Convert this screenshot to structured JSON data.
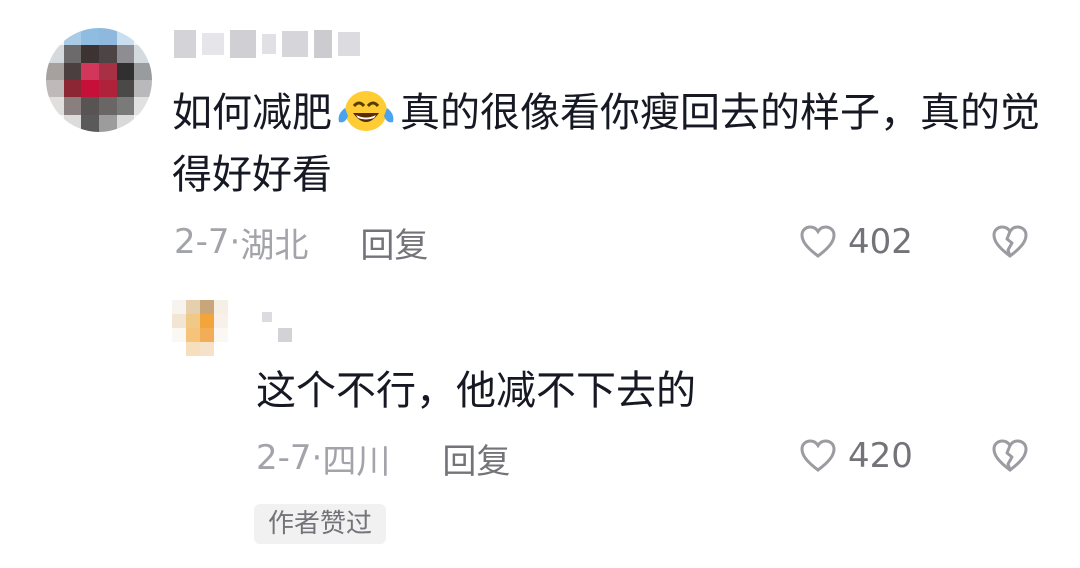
{
  "comments": {
    "main": {
      "avatar_icon": "blurred-avatar",
      "text_before_emoji": "如何减肥",
      "emoji": "laughing-crying-emoji",
      "text_after_emoji": "真的很像看你瘦回去的样子，真的觉得好好看",
      "date": "2-7·",
      "location": "湖北",
      "reply_label": "回复",
      "like_count": "402",
      "like_icon": "heart-outline-icon",
      "dislike_icon": "broken-heart-icon"
    },
    "reply": {
      "avatar_icon": "blurred-avatar",
      "text": "这个不行，他减不下去的",
      "date": "2-7·",
      "location": "四川",
      "reply_label": "回复",
      "like_count": "420",
      "like_icon": "heart-outline-icon",
      "dislike_icon": "broken-heart-icon",
      "author_badge": "作者赞过"
    }
  },
  "colors": {
    "text_primary": "#161823",
    "text_secondary": "#737379",
    "text_tertiary": "#a3a3aa",
    "badge_bg": "#f1f1f2"
  }
}
